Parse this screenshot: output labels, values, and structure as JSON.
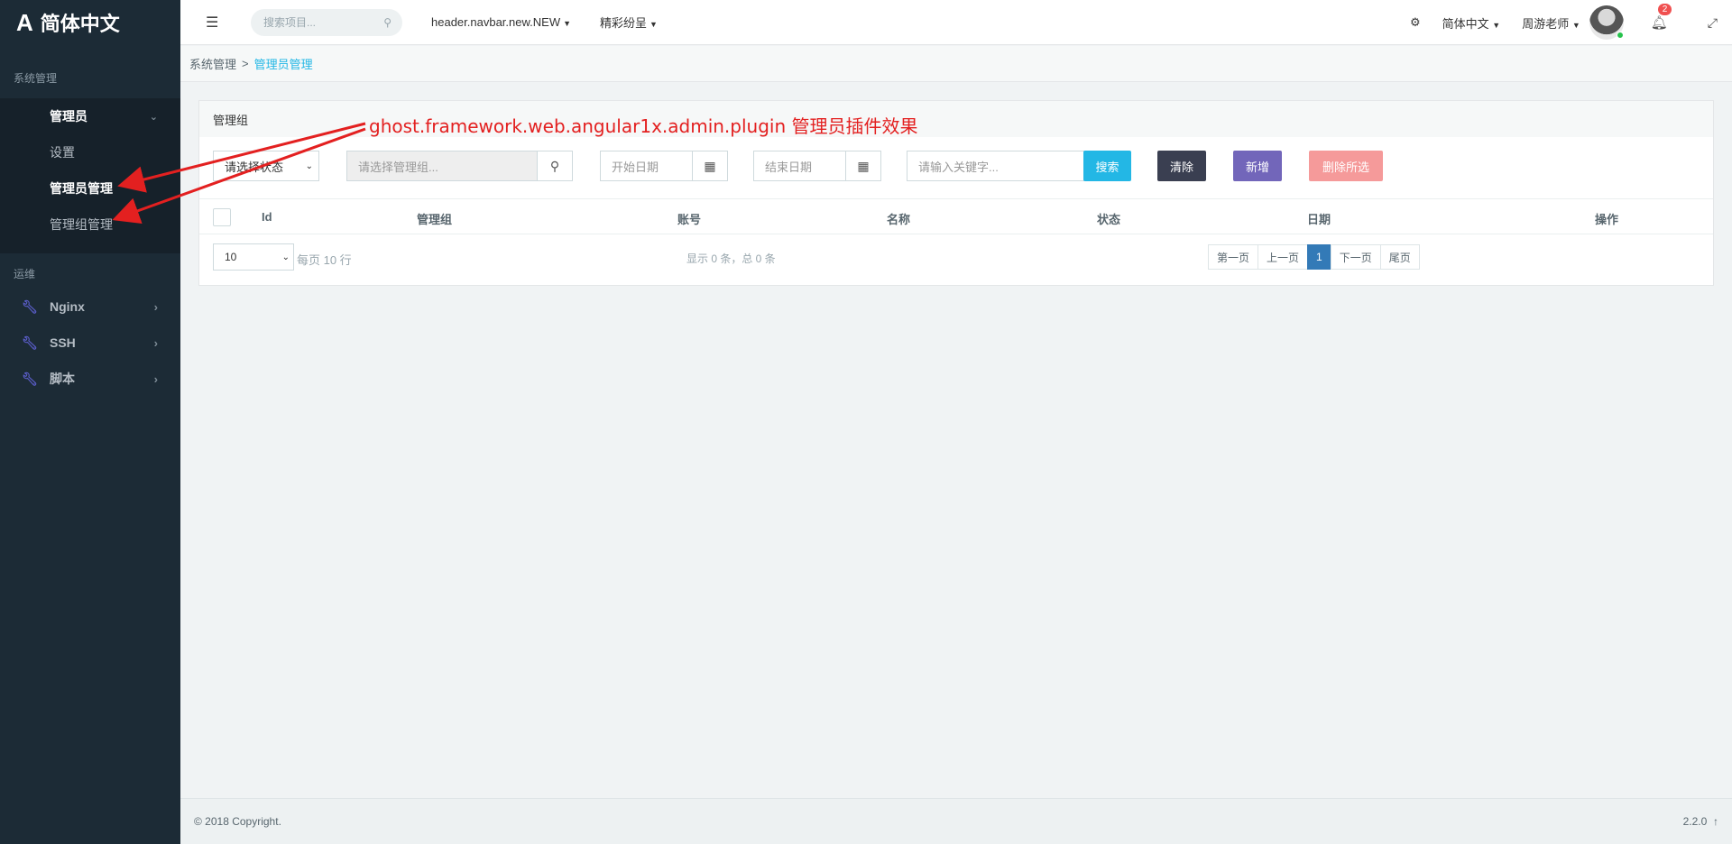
{
  "brand": {
    "logo": "A",
    "title": "简体中文"
  },
  "sidebar": {
    "section1": "系统管理",
    "items": [
      {
        "label": "管理员",
        "chevron": "⌄"
      },
      {
        "label": "设置"
      },
      {
        "label": "管理员管理"
      },
      {
        "label": "管理组管理"
      }
    ],
    "section2": "运维",
    "ops": [
      {
        "label": "Nginx",
        "icon": "wrench-icon"
      },
      {
        "label": "SSH",
        "icon": "wrench-icon"
      },
      {
        "label": "脚本",
        "icon": "wrench-icon"
      }
    ]
  },
  "header": {
    "search_placeholder": "搜索项目...",
    "link1": "header.navbar.new.NEW",
    "link2": "精彩纷呈",
    "lang": "简体中文",
    "user": "周游老师",
    "notif_count": "2"
  },
  "breadcrumb": {
    "root": "系统管理",
    "sep": ">",
    "current": "管理员管理"
  },
  "panel": {
    "title": "管理组",
    "status_placeholder": "请选择状态",
    "group_placeholder": "请选择管理组...",
    "start_date": "开始日期",
    "end_date": "结束日期",
    "keyword_placeholder": "请输入关键字...",
    "search_btn": "搜索",
    "clear_btn": "清除",
    "add_btn": "新增",
    "delete_btn": "删除所选",
    "columns": [
      "Id",
      "管理组",
      "账号",
      "名称",
      "状态",
      "日期",
      "操作"
    ],
    "page_size": "10",
    "per_page_text": "每页 10 行",
    "summary": "显示 0 条，总 0 条",
    "pager": [
      "第一页",
      "上一页",
      "1",
      "下一页",
      "尾页"
    ]
  },
  "annotation": "ghost.framework.web.angular1x.admin.plugin 管理员插件效果",
  "footer": {
    "copyright": "© 2018 Copyright.",
    "version": "2.2.0"
  },
  "colors": {
    "sidebar": "#1c2b36",
    "info": "#23b7e5",
    "dark": "#3a3f51",
    "purple": "#7266ba",
    "danger": "#f05050",
    "primary": "#337ab7"
  }
}
